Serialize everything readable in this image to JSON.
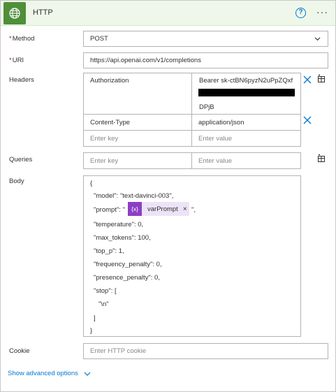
{
  "header": {
    "title": "HTTP",
    "help_glyph": "?",
    "more_glyph": "···"
  },
  "method": {
    "label": "Method",
    "required_mark": "*",
    "value": "POST"
  },
  "uri": {
    "label": "URI",
    "required_mark": "*",
    "value": "https://api.openai.com/v1/completions"
  },
  "headers": {
    "label": "Headers",
    "rows": [
      {
        "key": "Authorization",
        "value_line1": "Bearer sk-ctBN6pyzN2uPpZQxf",
        "value_line3": "DPjB"
      },
      {
        "key": "Content-Type",
        "value": "application/json"
      }
    ],
    "key_placeholder": "Enter key",
    "value_placeholder": "Enter value"
  },
  "queries": {
    "label": "Queries",
    "key_placeholder": "Enter key",
    "value_placeholder": "Enter value"
  },
  "body": {
    "label": "Body",
    "lines": {
      "open": "{",
      "model": "\"model\": \"text-davinci-003\",",
      "prompt_prefix": "\"prompt\": \"",
      "prompt_suffix": "\",",
      "temperature": "\"temperature\": 0,",
      "max_tokens": "\"max_tokens\": 100,",
      "top_p": "\"top_p\": 1,",
      "frequency_penalty": "\"frequency_penalty\": 0,",
      "presence_penalty": "\"presence_penalty\": 0,",
      "stop": "\"stop\": [",
      "newline": "\"\\n\"",
      "close_bracket": "]",
      "close": "}"
    },
    "token": {
      "icon_text": "{x}",
      "label": "varPrompt",
      "close": "×"
    }
  },
  "cookie": {
    "label": "Cookie",
    "placeholder": "Enter HTTP cookie"
  },
  "advanced": {
    "label": "Show advanced options"
  },
  "colors": {
    "header_bg": "#eef7e9",
    "icon_bg": "#4f8f3a",
    "accent": "#0078d4",
    "required": "#a4262c",
    "token_bg": "#ede3f6",
    "token_icon_bg": "#8c3fc6"
  },
  "icons": [
    "globe-icon",
    "help-icon",
    "more-icon",
    "chevron-down-icon",
    "close-icon",
    "table-icon"
  ]
}
